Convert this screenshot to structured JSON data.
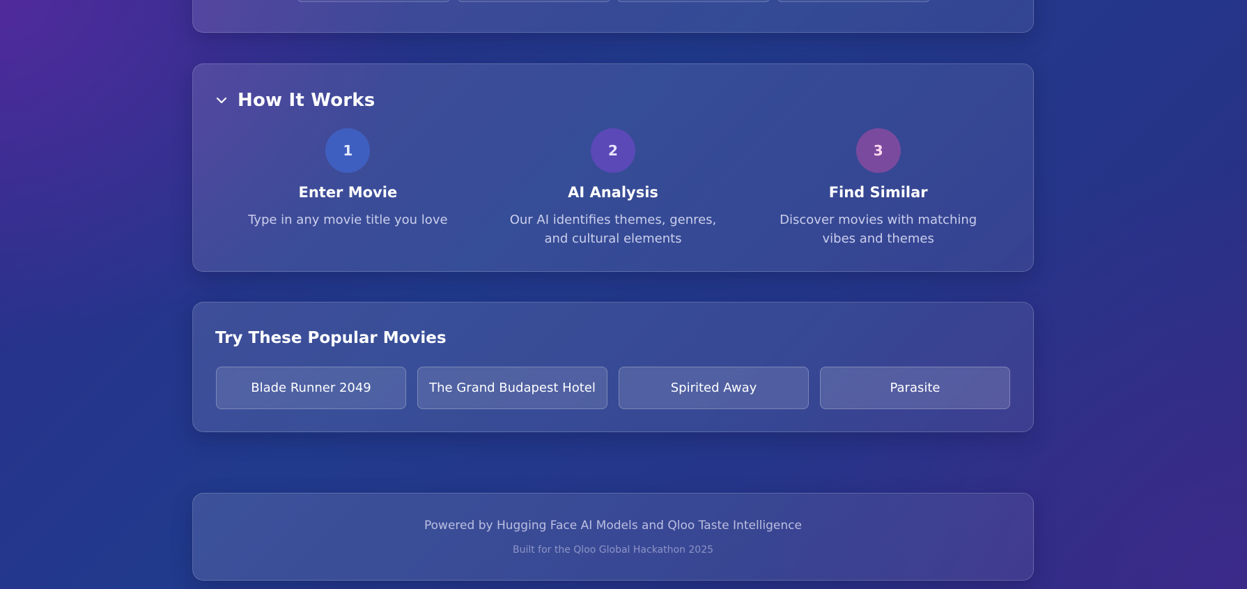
{
  "how_it_works": {
    "title": "How It Works",
    "steps": [
      {
        "number": "1",
        "title": "Enter Movie",
        "description": "Type in any movie title you love",
        "color": "#3f5fc0"
      },
      {
        "number": "2",
        "title": "AI Analysis",
        "description": "Our AI identifies themes, genres, and cultural elements",
        "color": "#5b49b8"
      },
      {
        "number": "3",
        "title": "Find Similar",
        "description": "Discover movies with matching vibes and themes",
        "color": "#7a4a9e"
      }
    ]
  },
  "popular": {
    "title": "Try These Popular Movies",
    "movies": [
      "Blade Runner 2049",
      "The Grand Budapest Hotel",
      "Spirited Away",
      "Parasite"
    ]
  },
  "footer": {
    "powered_by": "Powered by Hugging Face AI Models and Qloo Taste Intelligence",
    "built_for": "Built for the Qloo Global Hackathon 2025"
  }
}
